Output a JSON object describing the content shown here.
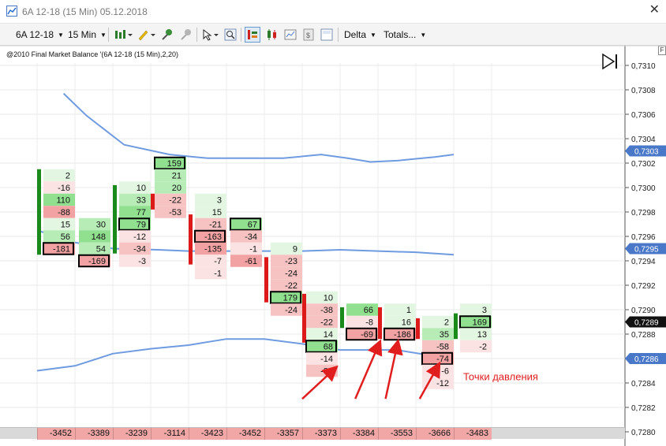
{
  "window": {
    "title": "6A 12-18 (15 Min)  05.12.2018",
    "close_glyph": "✕"
  },
  "toolbar": {
    "instrument": "6A 12-18",
    "interval": "15 Min",
    "delta_label": "Delta",
    "totals_label": "Totals...",
    "icons": [
      "bar-type-icon",
      "pencil-icon",
      "pin-icon",
      "pin-disabled-icon",
      "cursor-icon",
      "zoom-icon",
      "order-flow-icon",
      "candlestick-icon",
      "chart-properties-icon",
      "data-box-icon",
      "panel-icon"
    ]
  },
  "chart": {
    "header_text": "@2010 Final Market Balance  '(6A 12-18 (15 Min),2,20)",
    "f_label": "F",
    "y_axis": {
      "min": 0.728,
      "max": 0.731,
      "step": 0.0002,
      "tick_labels": [
        "0,7310",
        "0,7308",
        "0,7306",
        "0,7304",
        "0,7302",
        "0,7300",
        "0,7298",
        "0,7296",
        "0,7294",
        "0,7292",
        "0,7290",
        "0,7288",
        "0,7286",
        "0,7284",
        "0,7282",
        "0,7280"
      ]
    },
    "price_labels": [
      {
        "price": 0.7303,
        "text": "0,7303",
        "color": "#4a78c8"
      },
      {
        "price": 0.7295,
        "text": "0,7295",
        "color": "#4a78c8"
      },
      {
        "price": 0.7289,
        "text": "0,7289",
        "color": "#111111"
      },
      {
        "price": 0.7286,
        "text": "0,7286",
        "color": "#4a78c8"
      }
    ],
    "band_color": "#6f9be0",
    "bands": {
      "upper": [
        [
          0.7,
          0.73077
        ],
        [
          1.3,
          0.73059
        ],
        [
          2.3,
          0.73035
        ],
        [
          3.5,
          0.73027
        ],
        [
          4.5,
          0.73024
        ],
        [
          6.5,
          0.73024
        ],
        [
          7.5,
          0.73027
        ],
        [
          8.2,
          0.73024
        ],
        [
          8.8,
          0.73021
        ],
        [
          9.5,
          0.73022
        ],
        [
          10.5,
          0.73025
        ],
        [
          11.0,
          0.73027
        ]
      ],
      "middle": [
        [
          0.0,
          0.72965
        ],
        [
          1.0,
          0.72955
        ],
        [
          2.0,
          0.7295
        ],
        [
          3.2,
          0.72949
        ],
        [
          4.0,
          0.72948
        ],
        [
          5.5,
          0.72948
        ],
        [
          7.0,
          0.72948
        ],
        [
          8.0,
          0.72949
        ],
        [
          9.0,
          0.72948
        ],
        [
          10.0,
          0.72947
        ],
        [
          11.0,
          0.72945
        ]
      ],
      "lower": [
        [
          0.0,
          0.7285
        ],
        [
          1.0,
          0.72854
        ],
        [
          2.0,
          0.72864
        ],
        [
          3.0,
          0.72868
        ],
        [
          4.0,
          0.72871
        ],
        [
          5.0,
          0.72876
        ],
        [
          6.0,
          0.72876
        ],
        [
          7.0,
          0.72872
        ],
        [
          8.0,
          0.72867
        ],
        [
          9.5,
          0.72867
        ],
        [
          10.5,
          0.72862
        ],
        [
          11.0,
          0.7286
        ]
      ]
    },
    "candles": [
      {
        "bar": "green",
        "bar_top": 0.73015,
        "bar_bot": 0.72945,
        "left": [],
        "right": [
          [
            0.7301,
            "2"
          ],
          [
            0.73,
            "-16"
          ],
          [
            0.7299,
            "110"
          ],
          [
            0.7298,
            "-88"
          ],
          [
            0.7297,
            "15"
          ],
          [
            0.7296,
            "56"
          ],
          [
            0.7295,
            "-181"
          ]
        ],
        "boxed": [
          0.7295,
          "right"
        ]
      },
      {
        "bar": "none",
        "bar_top": 0,
        "bar_bot": 0,
        "left": [
          [
            0.7297,
            "30"
          ],
          [
            0.7296,
            "148"
          ],
          [
            0.7295,
            "54"
          ],
          [
            0.7294,
            "-169"
          ]
        ],
        "right": [],
        "boxed": [
          0.7294,
          "left"
        ]
      },
      {
        "bar": "green",
        "bar_top": 0.73002,
        "bar_bot": 0.72946,
        "left": [],
        "right": [
          [
            0.73,
            "10"
          ],
          [
            0.7299,
            "33"
          ],
          [
            0.7298,
            "77"
          ],
          [
            0.7297,
            "79"
          ],
          [
            0.7296,
            "-12"
          ],
          [
            0.7295,
            "-34"
          ],
          [
            0.7294,
            "-3"
          ]
        ],
        "boxed": [
          0.7297,
          "right"
        ]
      },
      {
        "bar": "red",
        "bar_top": 0.72995,
        "bar_bot": 0.72982,
        "left": [
          [
            0.7302,
            "159"
          ],
          [
            0.7301,
            "21"
          ],
          [
            0.73,
            "20"
          ],
          [
            0.7299,
            "-22"
          ],
          [
            0.7298,
            "-53"
          ]
        ],
        "right": [],
        "boxed": [
          0.7302,
          "left"
        ]
      },
      {
        "bar": "red",
        "bar_top": 0.72978,
        "bar_bot": 0.72937,
        "left": [],
        "right": [
          [
            0.7299,
            "3"
          ],
          [
            0.7298,
            "15"
          ],
          [
            0.7297,
            "-21"
          ],
          [
            0.7296,
            "-163"
          ],
          [
            0.7295,
            "-135"
          ],
          [
            0.7294,
            "-7"
          ],
          [
            0.7293,
            "-1"
          ]
        ],
        "boxed": [
          0.7296,
          "right"
        ]
      },
      {
        "bar": "none",
        "bar_top": 0,
        "bar_bot": 0,
        "left": [
          [
            0.7297,
            "67"
          ],
          [
            0.7296,
            "-34"
          ],
          [
            0.7295,
            "-1"
          ],
          [
            0.7294,
            "-61"
          ]
        ],
        "right": [],
        "boxed": [
          0.7297,
          "left"
        ]
      },
      {
        "bar": "red",
        "bar_top": 0.72943,
        "bar_bot": 0.72906,
        "left": [],
        "right": [
          [
            0.7295,
            "9"
          ],
          [
            0.7294,
            "-23"
          ],
          [
            0.7293,
            "-24"
          ],
          [
            0.7292,
            "-22"
          ],
          [
            0.7291,
            "179"
          ],
          [
            0.729,
            "-24"
          ]
        ],
        "boxed": [
          0.7291,
          "right"
        ]
      },
      {
        "bar": "red",
        "bar_top": 0.72913,
        "bar_bot": 0.72873,
        "left": [
          [
            0.7291,
            "10"
          ],
          [
            0.729,
            "-38"
          ],
          [
            0.7289,
            "-22"
          ],
          [
            0.7288,
            "14"
          ],
          [
            0.7287,
            "68"
          ],
          [
            0.7286,
            "-14"
          ],
          [
            0.7285,
            "-34"
          ]
        ],
        "right": [],
        "boxed": [
          0.7287,
          "left"
        ]
      },
      {
        "bar": "green",
        "bar_top": 0.72902,
        "bar_bot": 0.72885,
        "left": [],
        "right": [
          [
            0.729,
            "66"
          ],
          [
            0.7289,
            "-8"
          ],
          [
            0.7288,
            "-69"
          ]
        ],
        "boxed": [
          0.7288,
          "right"
        ]
      },
      {
        "bar": "red",
        "bar_top": 0.72902,
        "bar_bot": 0.72876,
        "left": [],
        "right": [
          [
            0.729,
            "1"
          ],
          [
            0.7289,
            "16"
          ],
          [
            0.7288,
            "-186"
          ]
        ],
        "boxed": [
          0.7288,
          "right"
        ]
      },
      {
        "bar": "red",
        "bar_top": 0.72893,
        "bar_bot": 0.72876,
        "left": [],
        "right": [
          [
            0.7289,
            "2"
          ],
          [
            0.7288,
            "35"
          ],
          [
            0.7287,
            "-58"
          ],
          [
            0.7286,
            "-74"
          ],
          [
            0.7285,
            "-6"
          ],
          [
            0.7284,
            "-12"
          ]
        ],
        "boxed": [
          0.7286,
          "right"
        ]
      },
      {
        "bar": "green",
        "bar_top": 0.72897,
        "bar_bot": 0.72876,
        "left": [],
        "right": [
          [
            0.729,
            "3"
          ],
          [
            0.7289,
            "169"
          ],
          [
            0.7288,
            "13"
          ],
          [
            0.7287,
            "-2"
          ]
        ],
        "boxed": [
          0.7289,
          "right"
        ]
      }
    ],
    "totals": [
      "-3452",
      "-3389",
      "-3239",
      "-3114",
      "-3423",
      "-3452",
      "-3357",
      "-3373",
      "-3384",
      "-3553",
      "-3666",
      "-3483"
    ],
    "annotation": {
      "text": "Точки давления",
      "price": 0.72845
    },
    "arrows": [
      {
        "from": [
          7.0,
          0.72827
        ],
        "to": [
          7.8,
          0.7285
        ]
      },
      {
        "from": [
          8.4,
          0.72827
        ],
        "to": [
          9.0,
          0.7287
        ]
      },
      {
        "from": [
          9.2,
          0.72827
        ],
        "to": [
          9.5,
          0.7287
        ]
      },
      {
        "from": [
          10.1,
          0.72827
        ],
        "to": [
          10.55,
          0.72852
        ]
      }
    ]
  }
}
